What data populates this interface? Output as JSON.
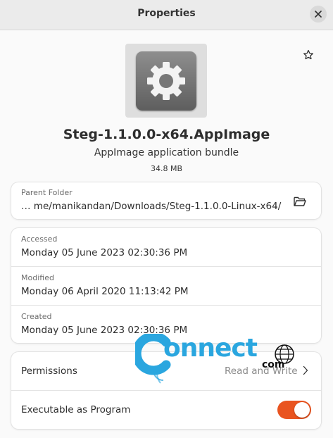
{
  "window": {
    "title": "Properties"
  },
  "header": {
    "file_name": "Steg-1.1.0.0-x64.AppImage",
    "file_type": "AppImage application bundle",
    "file_size": "34.8 MB"
  },
  "parent_folder": {
    "caption": "Parent Folder",
    "path": "…  me/manikandan/Downloads/Steg-1.1.0.0-Linux-x64/"
  },
  "times": [
    {
      "caption": "Accessed",
      "value": "Monday 05 June 2023 02:30:36 PM"
    },
    {
      "caption": "Modified",
      "value": "Monday 06 April 2020 11:13:42 PM"
    },
    {
      "caption": "Created",
      "value": "Monday 05 June 2023 02:30:36 PM"
    }
  ],
  "permissions": {
    "label": "Permissions",
    "value": "Read and Write",
    "executable_label": "Executable as Program",
    "executable_on": true
  },
  "watermark": {
    "brand": "onnect",
    "suffix": "com"
  },
  "colors": {
    "accent": "#e95420",
    "watermark": "#2aa6df"
  },
  "icons": [
    "close-icon",
    "star-icon",
    "gear-icon",
    "folder-open-icon",
    "chevron-right-icon",
    "globe-icon"
  ]
}
